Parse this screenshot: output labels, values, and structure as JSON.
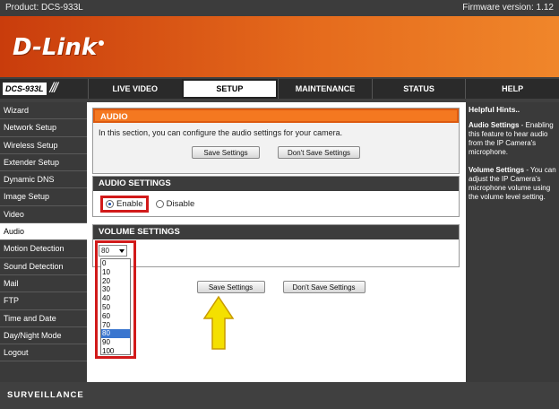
{
  "topbar": {
    "product": "Product: DCS-933L",
    "firmware": "Firmware version: 1.12"
  },
  "brand": {
    "logo": "D-Link"
  },
  "nav": {
    "model": "DCS-933L",
    "tabs": [
      "LIVE VIDEO",
      "SETUP",
      "MAINTENANCE",
      "STATUS",
      "HELP"
    ],
    "active_tab": "SETUP"
  },
  "sidebar": {
    "items": [
      "Wizard",
      "Network Setup",
      "Wireless Setup",
      "Extender Setup",
      "Dynamic DNS",
      "Image Setup",
      "Video",
      "Audio",
      "Motion Detection",
      "Sound Detection",
      "Mail",
      "FTP",
      "Time and Date",
      "Day/Night Mode",
      "Logout"
    ],
    "active": "Audio"
  },
  "audio": {
    "title": "AUDIO",
    "description": "In this section, you can configure the audio settings for your camera.",
    "save_label": "Save Settings",
    "dont_save_label": "Don't Save Settings"
  },
  "audio_settings": {
    "title": "AUDIO SETTINGS",
    "enable_label": "Enable",
    "disable_label": "Disable",
    "selected": "Enable"
  },
  "volume": {
    "title": "VOLUME SETTINGS",
    "value": "80",
    "options": [
      "0",
      "10",
      "20",
      "30",
      "40",
      "50",
      "60",
      "70",
      "80",
      "90",
      "100"
    ]
  },
  "bottom_buttons": {
    "save_label": "Save Settings",
    "dont_save_label": "Don't Save Settings"
  },
  "help": {
    "heading": "Helpful Hints..",
    "audio_title": "Audio Settings",
    "audio_text": " - Enabling this feature to hear audio from the IP Camera's microphone.",
    "volume_title": "Volume Settings",
    "volume_text": " - You can adjust the IP Camera's microphone volume using the volume level setting."
  },
  "footer": {
    "text": "SURVEILLANCE"
  },
  "colors": {
    "accent": "#f47820",
    "highlight": "#d11a1a",
    "arrow": "#f4e000"
  }
}
